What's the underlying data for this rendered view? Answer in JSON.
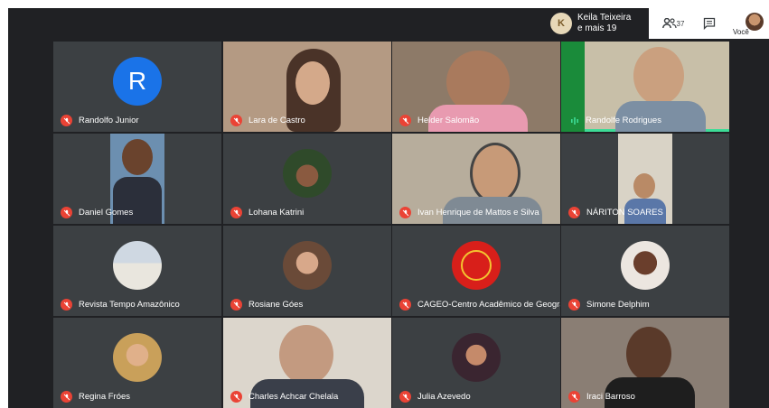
{
  "presenter": {
    "line1": "Keila Teixeira",
    "line2": "e mais 19"
  },
  "toolbar": {
    "people_count": "37",
    "you_label": "Você"
  },
  "participants": [
    {
      "name": "Randolfo Junior",
      "initial": "R"
    },
    {
      "name": "Lara de Castro"
    },
    {
      "name": "Helder Salomão"
    },
    {
      "name": "Randolfe Rodrigues"
    },
    {
      "name": "Daniel Gomes"
    },
    {
      "name": "Lohana Katrini"
    },
    {
      "name": "Ivan Henrique de Mattos e Silva"
    },
    {
      "name": "NÁRITON SOARES"
    },
    {
      "name": "Revista Tempo Amazônico"
    },
    {
      "name": "Rosiane Góes"
    },
    {
      "name": "CAGEO-Centro Acadêmico de Geografia"
    },
    {
      "name": "Simone Delphim"
    },
    {
      "name": "Regina Fróes"
    },
    {
      "name": "Charles Achcar Chelala"
    },
    {
      "name": "Julia Azevedo"
    },
    {
      "name": "Iraci Barroso"
    }
  ],
  "colors": {
    "stage": "#202124",
    "tile": "#3c4043",
    "avatar_blue": "#1a73e8",
    "mute_red": "#ea4335",
    "speaking_green": "#3ddc97"
  }
}
